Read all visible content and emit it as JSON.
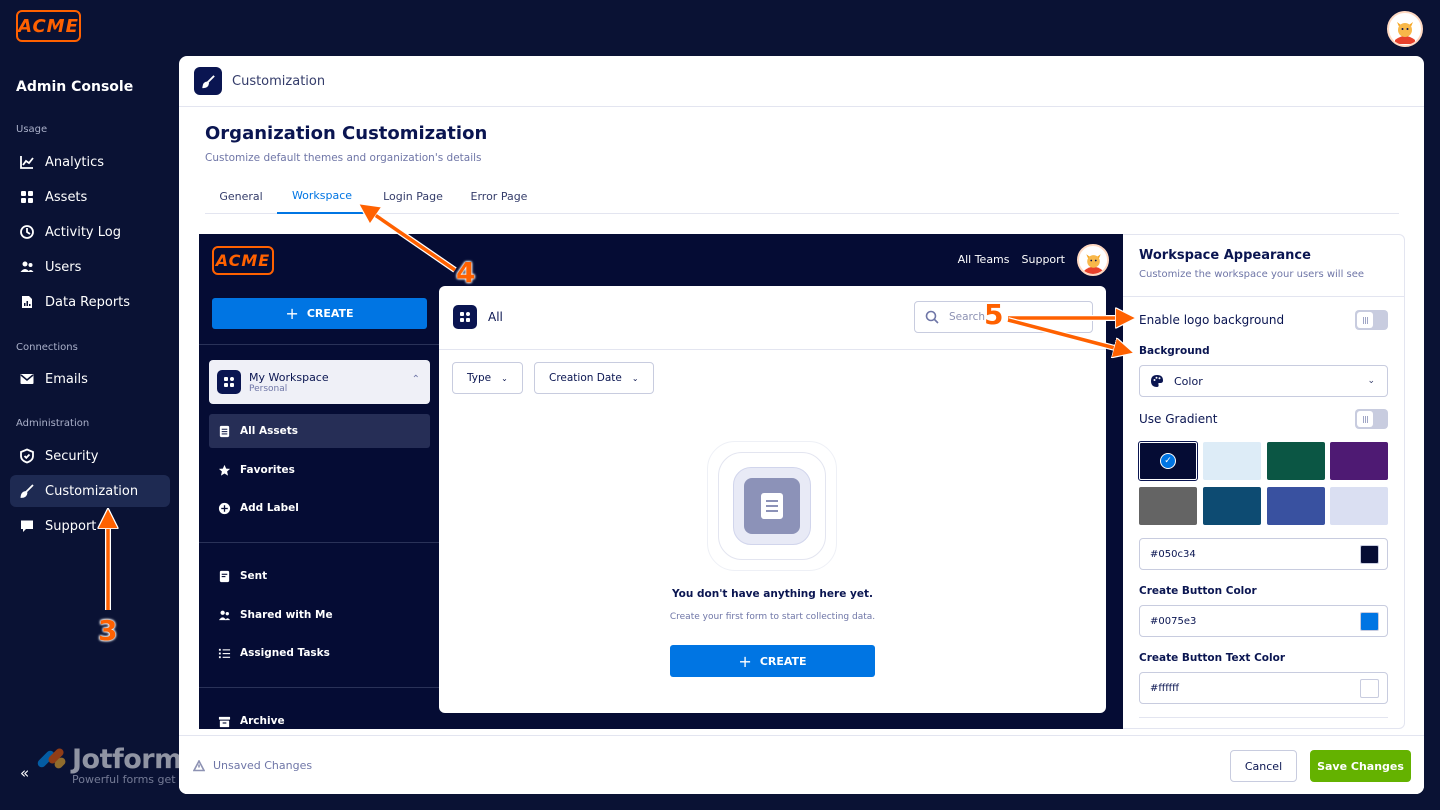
{
  "brand": {
    "logo_text": "ACME",
    "accent": "#ff6100"
  },
  "sidebar": {
    "title": "Admin Console",
    "sections": [
      {
        "label": "Usage"
      },
      {
        "label": "Connections"
      },
      {
        "label": "Administration"
      }
    ],
    "items": [
      {
        "label": "Analytics",
        "icon": "chart-line-icon"
      },
      {
        "label": "Assets",
        "icon": "grid-icon"
      },
      {
        "label": "Activity Log",
        "icon": "clock-icon"
      },
      {
        "label": "Users",
        "icon": "users-icon"
      },
      {
        "label": "Data Reports",
        "icon": "report-icon"
      },
      {
        "label": "Emails",
        "icon": "envelope-icon"
      },
      {
        "label": "Security",
        "icon": "shield-icon"
      },
      {
        "label": "Customization",
        "icon": "brush-icon",
        "active": true
      },
      {
        "label": "Support",
        "icon": "support-icon"
      }
    ],
    "collapse_label": "«",
    "jotform": {
      "name": "Jotform",
      "tagline": "Powerful forms get it done."
    }
  },
  "header": {
    "breadcrumb": "Customization"
  },
  "page": {
    "title": "Organization Customization",
    "subtitle": "Customize default themes and organization's details",
    "tabs": [
      {
        "label": "General"
      },
      {
        "label": "Workspace",
        "active": true
      },
      {
        "label": "Login Page"
      },
      {
        "label": "Error Page"
      }
    ]
  },
  "preview": {
    "logo_text": "ACME",
    "links": [
      "All Teams",
      "Support"
    ],
    "create_label": "CREATE",
    "workspace": {
      "name": "My Workspace",
      "type": "Personal"
    },
    "nav": [
      {
        "label": "All Assets",
        "active": true
      },
      {
        "label": "Favorites"
      },
      {
        "label": "Add Label"
      },
      {
        "label": "Sent"
      },
      {
        "label": "Shared with Me"
      },
      {
        "label": "Assigned Tasks"
      },
      {
        "label": "Archive"
      }
    ],
    "card": {
      "title": "All",
      "search_placeholder": "Search",
      "filters": [
        "Type",
        "Creation Date"
      ],
      "empty_title": "You don't have anything here yet.",
      "empty_sub": "Create your first form to start collecting data.",
      "create_label": "CREATE"
    }
  },
  "settings": {
    "title": "Workspace Appearance",
    "subtitle": "Customize the workspace your users will see",
    "logo_bg_label": "Enable logo background",
    "logo_bg_enabled": false,
    "background_label": "Background",
    "background_type": "Color",
    "gradient_label": "Use Gradient",
    "gradient_enabled": false,
    "swatches": [
      "#050c34",
      "#ddecf7",
      "#0b5644",
      "#4e1a73",
      "#646464",
      "#0d4b72",
      "#3951a0",
      "#dadff2"
    ],
    "selected_swatch": 0,
    "background_hex": "#050c34",
    "create_btn_label": "Create Button Color",
    "create_btn_hex": "#0075e3",
    "create_btn_text_label": "Create Button Text Color",
    "create_btn_text_hex": "#ffffff"
  },
  "footer": {
    "unsaved_label": "Unsaved Changes",
    "cancel_label": "Cancel",
    "save_label": "Save Changes",
    "save_color": "#64b200"
  },
  "annotations": {
    "step_3": "3",
    "step_4": "4",
    "step_5": "5"
  }
}
